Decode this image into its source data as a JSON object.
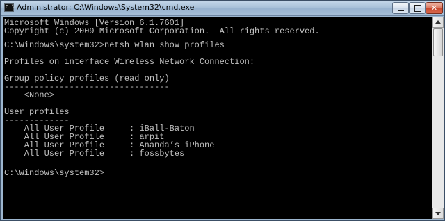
{
  "window": {
    "title": "Administrator: C:\\Windows\\System32\\cmd.exe",
    "icon_glyph": "C:\\",
    "buttons": {
      "minimize": "minimize-icon",
      "maximize": "maximize-icon",
      "close": "close-icon",
      "close_label": "✕"
    }
  },
  "console": {
    "lines": [
      "Microsoft Windows [Version 6.1.7601]",
      "Copyright (c) 2009 Microsoft Corporation.  All rights reserved.",
      "",
      "C:\\Windows\\system32>netsh wlan show profiles",
      "",
      "Profiles on interface Wireless Network Connection:",
      "",
      "Group policy profiles (read only)",
      "---------------------------------",
      "    <None>",
      "",
      "User profiles",
      "-------------",
      "    All User Profile     : iBall-Baton",
      "    All User Profile     : arpit",
      "    All User Profile     : Ananda’s iPhone",
      "    All User Profile     : fossbytes",
      "",
      "C:\\Windows\\system32>"
    ]
  },
  "colors": {
    "console_background": "#000000",
    "console_text": "#c0c0c0",
    "titlebar": "#a9c1d9"
  }
}
